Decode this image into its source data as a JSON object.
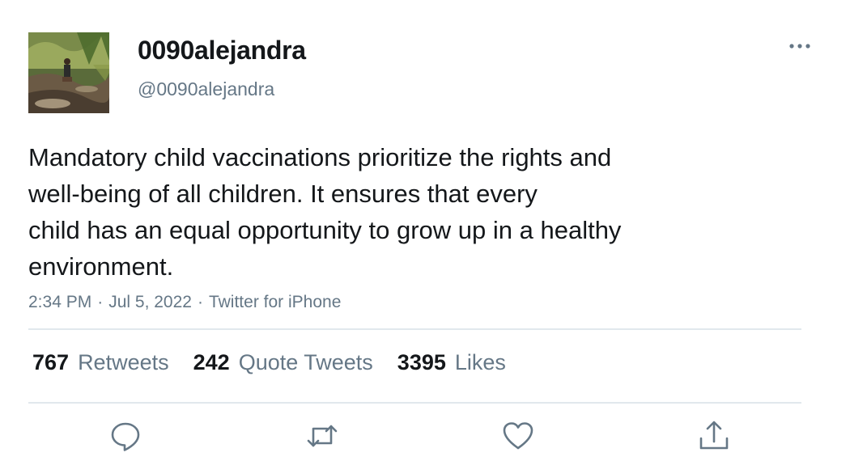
{
  "user": {
    "display_name": "0090alejandra",
    "handle": "@0090alejandra",
    "avatar_icon": "profile-photo-icon"
  },
  "tweet": {
    "text": "Mandatory child vaccinations prioritize the rights and\nwell-being of all children. It ensures that every\nchild has an equal opportunity to grow up in a healthy\nenvironment.",
    "time": "2:34 PM",
    "date": "Jul 5, 2022",
    "source": "Twitter for iPhone",
    "separator": "·"
  },
  "stats": {
    "retweets_count": "767",
    "retweets_label": "Retweets",
    "quotes_count": "242",
    "quotes_label": "Quote Tweets",
    "likes_count": "3395",
    "likes_label": "Likes"
  },
  "actions": {
    "reply_icon": "reply-icon",
    "retweet_icon": "retweet-icon",
    "like_icon": "heart-icon",
    "share_icon": "share-icon",
    "more_icon": "more-options-icon"
  },
  "colors": {
    "text_primary": "#14171a",
    "text_secondary": "#657786",
    "divider": "#e1e8ed"
  }
}
